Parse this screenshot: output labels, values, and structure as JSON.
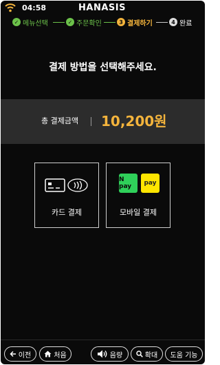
{
  "status": {
    "time": "04:58",
    "brand": "HANASIS",
    "icon": "wifi-icon"
  },
  "steps": [
    {
      "label": "메뉴선택",
      "marker": "✓",
      "state": "done"
    },
    {
      "label": "주문확인",
      "marker": "✓",
      "state": "done"
    },
    {
      "label": "결제하기",
      "marker": "3",
      "state": "active"
    },
    {
      "label": "완료",
      "marker": "4",
      "state": "todo"
    }
  ],
  "heading": "결제 방법을 선택해주세요.",
  "amount": {
    "label": "총 결제금액",
    "value": "10,200원"
  },
  "payment_options": [
    {
      "label": "카드 결제",
      "icon": "credit-card-contactless-icon"
    },
    {
      "label": "모바일 결제",
      "icon": "mobile-pay-icon",
      "badges": [
        "N pay",
        "pay"
      ]
    }
  ],
  "nav": {
    "back": "이전",
    "home": "처음",
    "volume": "음량",
    "zoom": "확대",
    "help": "도움 기능"
  },
  "colors": {
    "accent": "#f4b43c",
    "done": "#6cc24a",
    "npay": "#2fd05a",
    "kpay": "#fee500",
    "background": "#0a0a0a"
  }
}
